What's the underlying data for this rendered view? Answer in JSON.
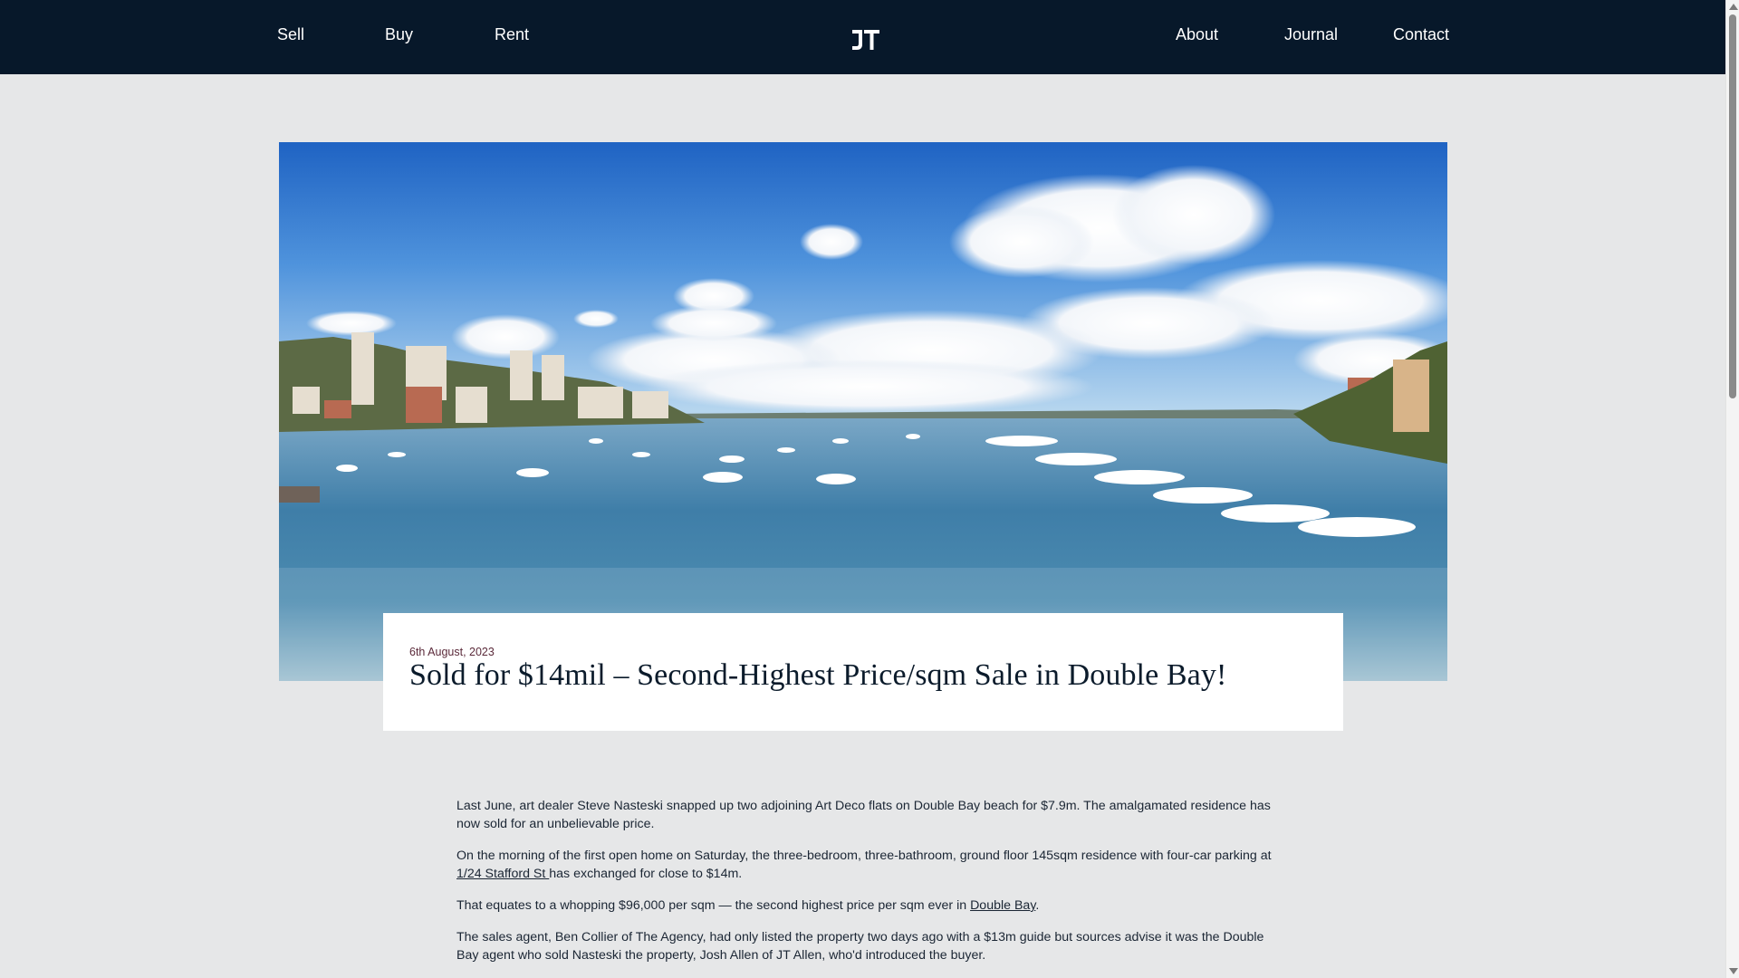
{
  "nav": {
    "left": [
      {
        "label": "Sell"
      },
      {
        "label": "Buy"
      },
      {
        "label": "Rent"
      }
    ],
    "logo_text": "JT",
    "right": [
      {
        "label": "About"
      },
      {
        "label": "Journal"
      },
      {
        "label": "Contact"
      }
    ]
  },
  "colors": {
    "nav_bg": "#07182a",
    "page_bg": "#e6e7e8",
    "date_color": "#5b2a3a"
  },
  "hero": {
    "image_subject": "harbour-bay-with-boats-and-apartments"
  },
  "article": {
    "date": "6th August, 2023",
    "title": "Sold for $14mil – Second-Highest Price/sqm Sale in Double Bay!",
    "p1": "Last June, art dealer Steve Nasteski snapped up two adjoining Art Deco flats on Double Bay beach for $7.9m. The amalgamated residence has now sold for an unbelievable price.",
    "p2_before": "On the morning of the first open home on Saturday, the three-bedroom, three-bathroom, ground floor 145sqm residence with four-car parking at ",
    "p2_link": "1/24 Stafford St ",
    "p2_after": "has exchanged for close to $14m.",
    "p3_before": "That equates to a whopping $96,000 per sqm — the second highest price per sqm ever in ",
    "p3_link": "Double Bay",
    "p3_after": ".",
    "p4": "The sales agent, Ben Collier of The Agency, had only listed the property two days ago with a $13m guide but sources advise it was the Double Bay agent who sold Nasteski the property, Josh Allen of JT Allen, who'd introduced the buyer."
  }
}
